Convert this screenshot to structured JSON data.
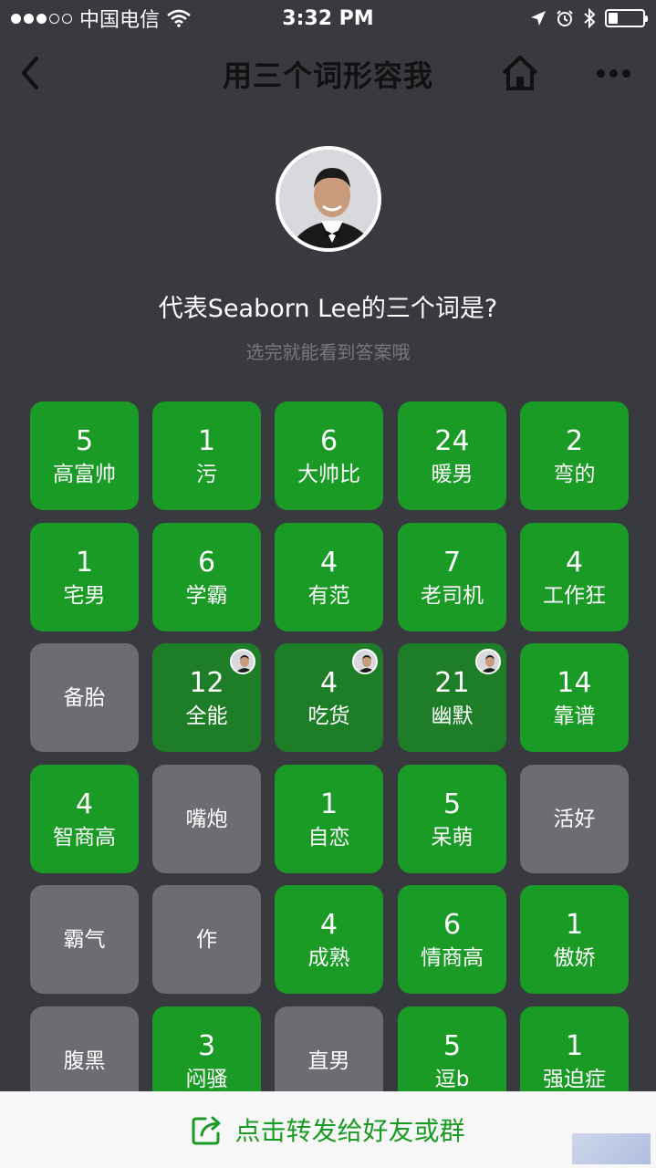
{
  "status_bar": {
    "carrier": "中国电信",
    "time": "3:32 PM"
  },
  "nav": {
    "title": "用三个词形容我"
  },
  "profile": {
    "question": "代表Seaborn Lee的三个词是?",
    "hint": "选完就能看到答案哦"
  },
  "tiles": [
    {
      "count": "5",
      "word": "高富帅",
      "state": "green"
    },
    {
      "count": "1",
      "word": "污",
      "state": "green"
    },
    {
      "count": "6",
      "word": "大帅比",
      "state": "green"
    },
    {
      "count": "24",
      "word": "暖男",
      "state": "green"
    },
    {
      "count": "2",
      "word": "弯的",
      "state": "green"
    },
    {
      "count": "1",
      "word": "宅男",
      "state": "green"
    },
    {
      "count": "6",
      "word": "学霸",
      "state": "green"
    },
    {
      "count": "4",
      "word": "有范",
      "state": "green"
    },
    {
      "count": "7",
      "word": "老司机",
      "state": "green"
    },
    {
      "count": "4",
      "word": "工作狂",
      "state": "green"
    },
    {
      "count": "",
      "word": "备胎",
      "state": "gray"
    },
    {
      "count": "12",
      "word": "全能",
      "state": "mine"
    },
    {
      "count": "4",
      "word": "吃货",
      "state": "mine"
    },
    {
      "count": "21",
      "word": "幽默",
      "state": "mine"
    },
    {
      "count": "14",
      "word": "靠谱",
      "state": "green"
    },
    {
      "count": "4",
      "word": "智商高",
      "state": "green"
    },
    {
      "count": "",
      "word": "嘴炮",
      "state": "gray"
    },
    {
      "count": "1",
      "word": "自恋",
      "state": "green"
    },
    {
      "count": "5",
      "word": "呆萌",
      "state": "green"
    },
    {
      "count": "",
      "word": "活好",
      "state": "gray"
    },
    {
      "count": "",
      "word": "霸气",
      "state": "gray"
    },
    {
      "count": "",
      "word": "作",
      "state": "gray"
    },
    {
      "count": "4",
      "word": "成熟",
      "state": "green"
    },
    {
      "count": "6",
      "word": "情商高",
      "state": "green"
    },
    {
      "count": "1",
      "word": "傲娇",
      "state": "green"
    },
    {
      "count": "",
      "word": "腹黑",
      "state": "gray"
    },
    {
      "count": "3",
      "word": "闷骚",
      "state": "green"
    },
    {
      "count": "",
      "word": "直男",
      "state": "gray"
    },
    {
      "count": "5",
      "word": "逗b",
      "state": "green"
    },
    {
      "count": "1",
      "word": "强迫症",
      "state": "green"
    }
  ],
  "bottom_bar": {
    "share_label": "点击转发给好友或群"
  },
  "colors": {
    "background": "#393a3f",
    "green_tile": "#1a9b26",
    "selected_tile": "#1e7e27",
    "gray_tile": "#6c6c72",
    "share_text": "#1a9b26"
  },
  "icons": {
    "back": "chevron-left-icon",
    "home": "home-icon",
    "more": "more-dots-icon",
    "share": "share-icon",
    "wifi": "wifi-icon",
    "location": "location-arrow-icon",
    "alarm": "alarm-icon",
    "bluetooth": "bluetooth-icon",
    "battery": "battery-icon"
  }
}
